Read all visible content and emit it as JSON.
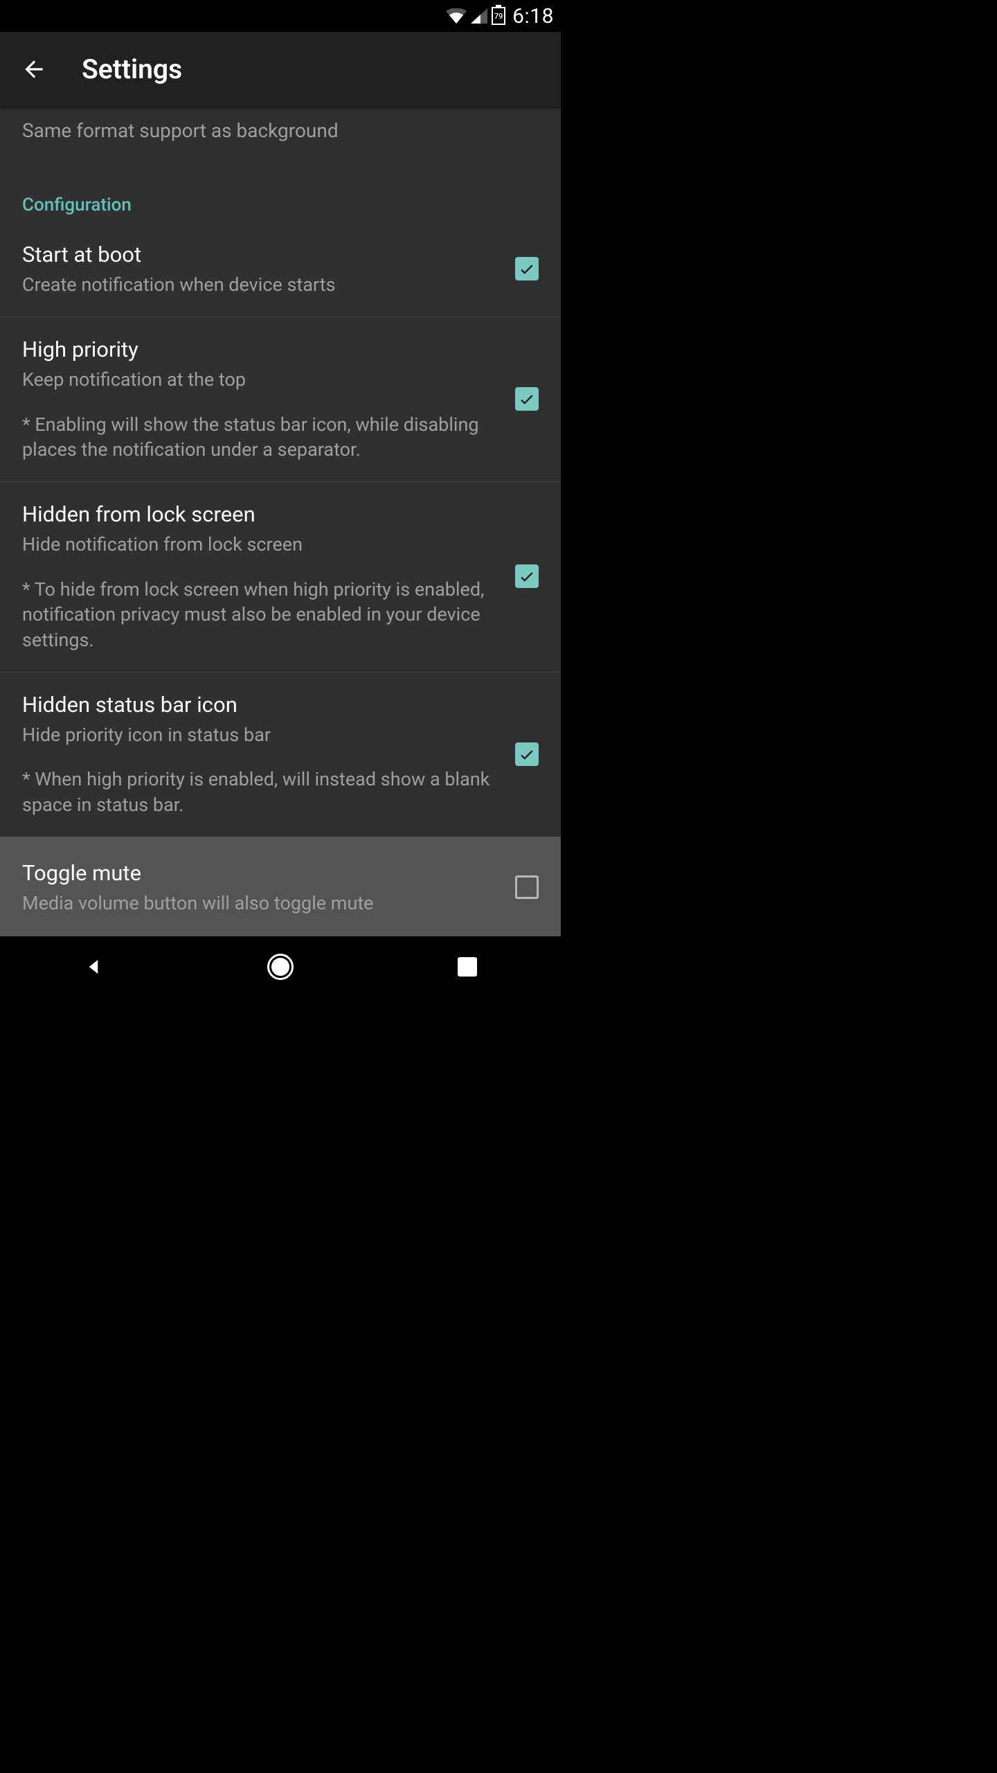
{
  "status": {
    "battery": "79",
    "time": "6:18"
  },
  "header": {
    "title": "Settings"
  },
  "content": {
    "truncated_previous_desc": "Same format support as background",
    "section": "Configuration",
    "items": [
      {
        "title": "Start at boot",
        "sub": "Create notification when device starts",
        "note": "",
        "checked": true
      },
      {
        "title": "High priority",
        "sub": "Keep notification at the top",
        "note": "* Enabling will show the status bar icon, while disabling places the notification under a separator.",
        "checked": true
      },
      {
        "title": "Hidden from lock screen",
        "sub": "Hide notification from lock screen",
        "note": "* To hide from lock screen when high priority is enabled, notification privacy must also be enabled in your device settings.",
        "checked": true
      },
      {
        "title": "Hidden status bar icon",
        "sub": "Hide priority icon in status bar",
        "note": "* When high priority is enabled, will instead show a blank space in status bar.",
        "checked": true
      },
      {
        "title": "Toggle mute",
        "sub": "Media volume button will also toggle mute",
        "note": "",
        "checked": false
      }
    ]
  }
}
